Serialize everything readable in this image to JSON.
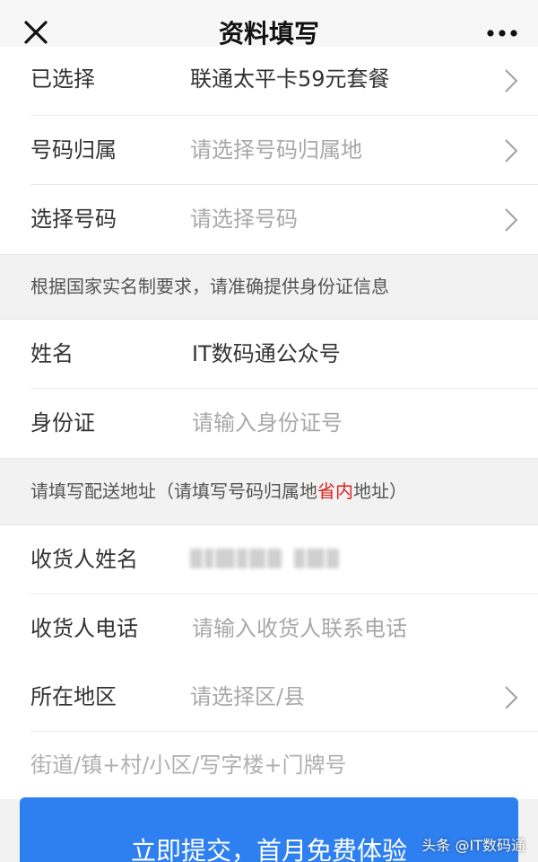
{
  "nav": {
    "title": "资料填写"
  },
  "plan": {
    "label": "已选择",
    "value": "联通太平卡59元套餐"
  },
  "location": {
    "label": "号码归属",
    "placeholder": "请选择号码归属地"
  },
  "number": {
    "label": "选择号码",
    "placeholder": "请选择号码"
  },
  "notice_id": "根据国家实名制要求，请准确提供身份证信息",
  "name": {
    "label": "姓名",
    "value": "IT数码通公众号"
  },
  "id_card": {
    "label": "身份证",
    "placeholder": "请输入身份证号"
  },
  "notice_address": {
    "prefix": "请填写配送地址（请填写号码归属地",
    "highlight": "省内",
    "suffix": "地址）",
    "highlight_color": "#e02020"
  },
  "receiver_name": {
    "label": "收货人姓名"
  },
  "receiver_phone": {
    "label": "收货人电话",
    "placeholder": "请输入收货人联系电话"
  },
  "region": {
    "label": "所在地区",
    "placeholder": "请选择区/县"
  },
  "street": {
    "placeholder": "街道/镇+村/小区/写字楼+门牌号"
  },
  "submit": {
    "label": "立即提交，首月免费体验",
    "color": "#2e7ff0"
  },
  "watermark": "头条 @IT数码通"
}
